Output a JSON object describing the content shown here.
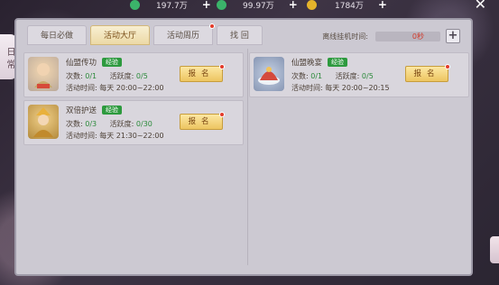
{
  "currencies": [
    {
      "icon": "green-coin-icon",
      "value": "197.7万",
      "color": "#3bb36a"
    },
    {
      "icon": "green-gem-icon",
      "value": "99.97万",
      "color": "#3bb36a"
    },
    {
      "icon": "gold-coin-icon",
      "value": "1784万",
      "color": "#e5b42b"
    }
  ],
  "side_tab": "日常",
  "tabs": [
    {
      "label": "每日必做",
      "active": false,
      "dot": false
    },
    {
      "label": "活动大厅",
      "active": true,
      "dot": false
    },
    {
      "label": "活动周历",
      "active": false,
      "dot": true
    },
    {
      "label": "找 回",
      "active": false,
      "dot": false
    }
  ],
  "idle": {
    "label": "离线挂机时间:",
    "value": "0秒"
  },
  "activities": [
    {
      "name": "仙盟传功",
      "badge": "经验",
      "count_label": "次数:",
      "count": "0/1",
      "activity_label": "活跃度:",
      "activity": "0/5",
      "time_label": "活动时间:",
      "time": "每天 20:00~22:00",
      "button": "报名"
    },
    {
      "name": "仙盟晚宴",
      "badge": "经验",
      "count_label": "次数:",
      "count": "0/1",
      "activity_label": "活跃度:",
      "activity": "0/5",
      "time_label": "活动时间:",
      "time": "每天 20:00~20:15",
      "button": "报名"
    },
    {
      "name": "双倍护送",
      "badge": "经验",
      "count_label": "次数:",
      "count": "0/3",
      "activity_label": "活跃度:",
      "activity": "0/30",
      "time_label": "活动时间:",
      "time": "每天 21:30~22:00",
      "button": "报名"
    }
  ]
}
